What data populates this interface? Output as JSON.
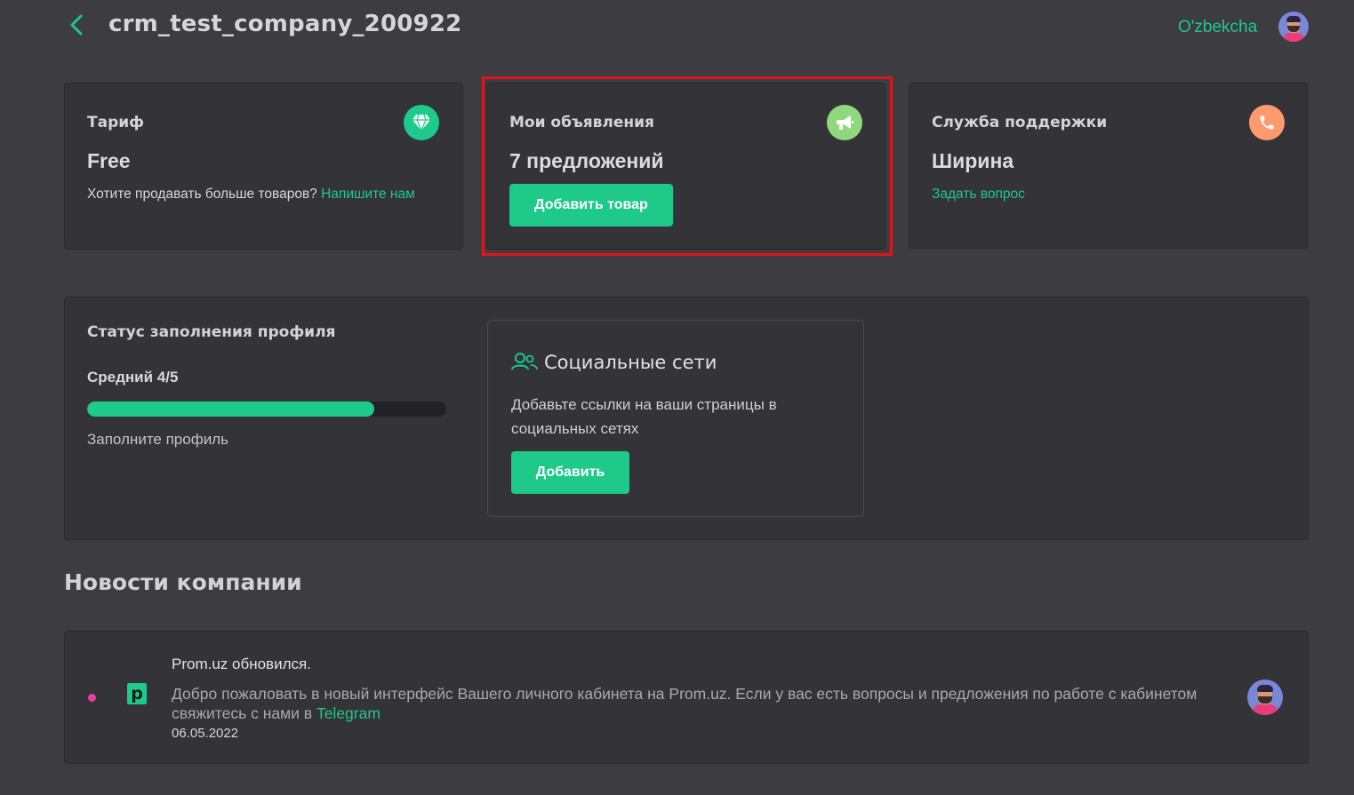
{
  "header": {
    "company_name": "crm_test_company_200922",
    "language_link": "O'zbekcha"
  },
  "cards": {
    "tariff": {
      "title": "Тариф",
      "plan": "Free",
      "text": "Хотите продавать больше товаров?",
      "link": "Напишите нам",
      "icon": "diamond-icon",
      "icon_color": "#1ec98a"
    },
    "ads": {
      "title": "Мои объявления",
      "count": "7 предложений",
      "button": "Добавить товар",
      "icon": "megaphone-icon",
      "icon_color": "#8fd87e"
    },
    "support": {
      "title": "Служба поддержки",
      "manager": "Ширина",
      "link": "Задать вопрос",
      "icon": "phone-icon",
      "icon_color": "#ff9a6e"
    }
  },
  "profile": {
    "title": "Статус заполнения профиля",
    "level": "Средний 4/5",
    "progress_fraction": 0.8,
    "hint": "Заполните профиль"
  },
  "social": {
    "title": "Социальные сети",
    "text": "Добавьте ссылки на ваши страницы в социальных сетях",
    "button": "Добавить"
  },
  "news": {
    "heading": "Новости компании",
    "items": [
      {
        "title": "Prom.uz обновился.",
        "body": "Добро пожаловать в новый интерфейс Вашего личного кабинета на Prom.uz. Если у вас есть вопросы и предложения по работе с кабинетом свяжитесь с нами в",
        "link": "Telegram",
        "date": "06.05.2022",
        "logo_letter": "p"
      }
    ]
  },
  "colors": {
    "accent": "#1ec98a",
    "background": "#3c3c41",
    "card": "#333338",
    "highlight": "#e0141c"
  }
}
